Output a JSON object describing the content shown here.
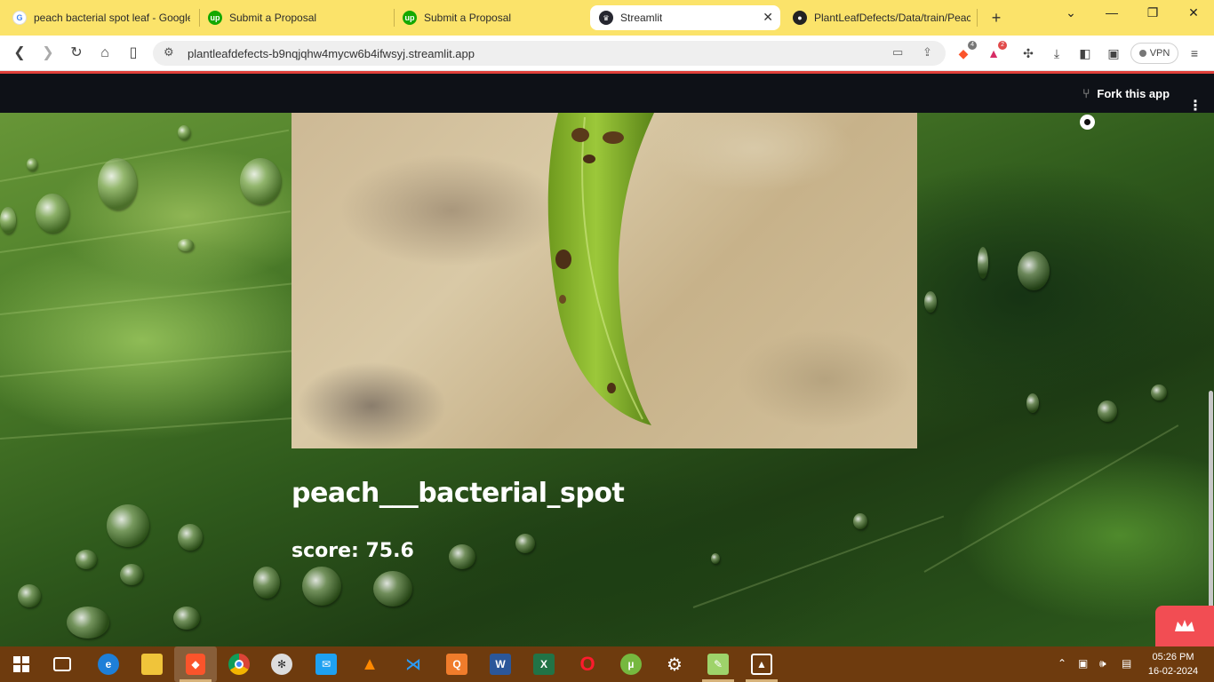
{
  "browser": {
    "tabs": [
      {
        "label": "peach bacterial spot leaf - Google",
        "favicon": "google-icon",
        "active": false
      },
      {
        "label": "Submit a Proposal",
        "favicon": "upwork-icon",
        "active": false
      },
      {
        "label": "Submit a Proposal",
        "favicon": "upwork-icon",
        "active": false
      },
      {
        "label": "Streamlit",
        "favicon": "streamlit-icon",
        "active": true
      },
      {
        "label": "PlantLeafDefects/Data/train/Peac",
        "favicon": "github-icon",
        "active": false
      }
    ],
    "url": "plantleafdefects-b9nqjqhw4mycw6b4ifwsyj.streamlit.app",
    "brave_badge": "4",
    "rewards_badge": "2",
    "vpn_label": "VPN"
  },
  "app": {
    "header": {
      "fork_label": "Fork this app"
    },
    "prediction": {
      "label": "peach___bacterial_spot",
      "score_text": "score: 75.6"
    }
  },
  "taskbar": {
    "apps": [
      "start-icon",
      "task-view-icon",
      "edge-icon",
      "file-explorer-icon",
      "brave-icon",
      "chrome-icon",
      "davinci-icon",
      "messenger-icon",
      "vlc-icon",
      "vscode-icon",
      "qt-icon",
      "word-icon",
      "excel-icon",
      "opera-icon",
      "utorrent-icon",
      "settings-icon",
      "notepad-icon",
      "photos-icon"
    ],
    "time": "05:26 PM",
    "date": "16-02-2024"
  },
  "colors": {
    "tab_strip": "#fbe36a",
    "streamlit_header": "#0e1117",
    "manage_button": "#f24d53",
    "taskbar": "#6e3b0e"
  }
}
